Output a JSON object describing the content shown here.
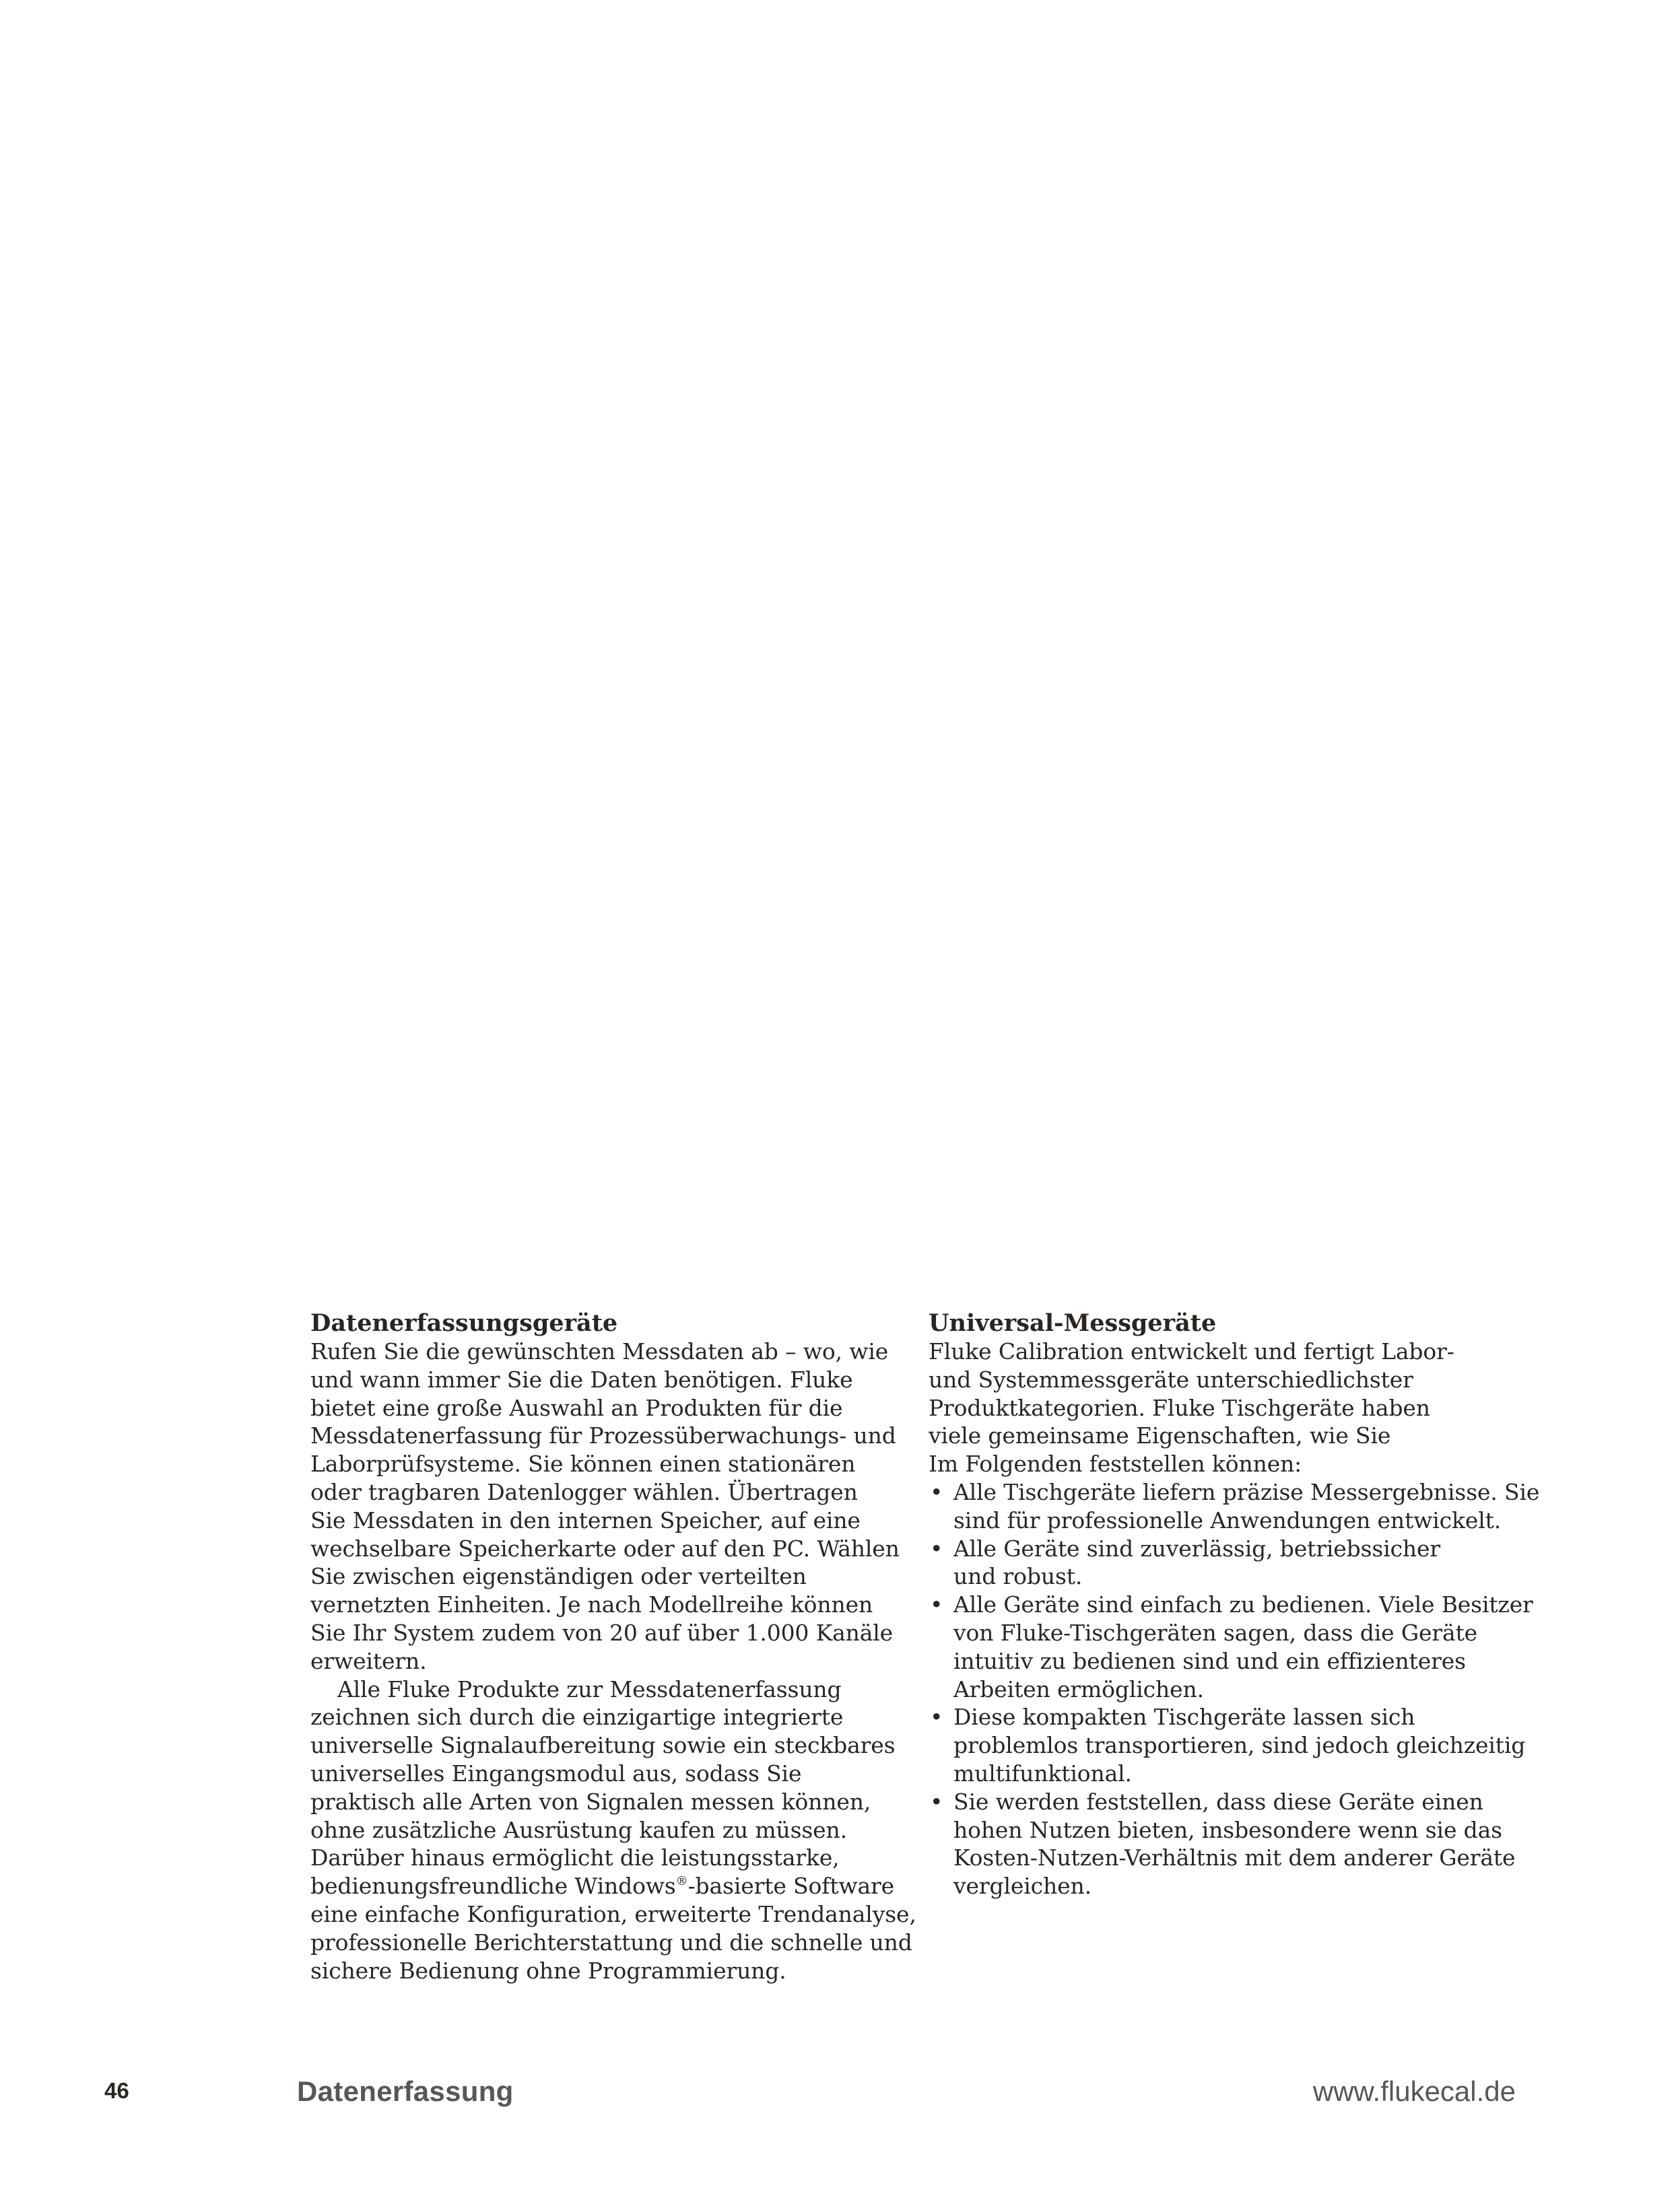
{
  "left_column": {
    "heading": "Datenerfassungsgeräte",
    "paragraph1": [
      "Rufen Sie die gewünschten Messdaten ab – wo, wie",
      "und wann immer Sie die Daten benötigen. Fluke",
      "bietet eine große Auswahl an Produkten für die",
      "Messdatenerfassung für Prozessüberwachungs- und",
      "Laborprüfsysteme. Sie können einen stationären",
      "oder tragbaren Datenlogger wählen. Übertragen",
      "Sie Messdaten in den internen Speicher, auf eine",
      "wechselbare Speicherkarte oder auf den PC. Wählen",
      "Sie zwischen eigenständigen oder verteilten",
      "vernetzten Einheiten. Je nach Modellreihe können",
      "Sie Ihr System zudem von 20 auf über 1.000 Kanäle",
      "erweitern."
    ],
    "paragraph2": [
      "Alle Fluke Produkte zur Messdatenerfassung",
      "zeichnen sich durch die einzigartige integrierte",
      "universelle Signalaufbereitung sowie ein steckbares",
      "universelles Eingangsmodul aus, sodass Sie",
      "praktisch alle Arten von Signalen messen können,",
      "ohne zusätzliche Ausrüstung kaufen zu müssen.",
      "Darüber hinaus ermöglicht die leistungsstarke,"
    ],
    "windows_line": {
      "before": "bedienungsfreundliche Windows",
      "reg": "®",
      "after": "-basierte Software"
    },
    "paragraph2_end": [
      "eine einfache Konfiguration, erweiterte Trendanalyse,",
      "professionelle Berichterstattung und die schnelle und",
      "sichere Bedienung ohne Programmierung."
    ]
  },
  "right_column": {
    "heading": "Universal-Messgeräte",
    "intro": [
      "Fluke Calibration entwickelt und fertigt Labor-",
      "und Systemmessgeräte unterschiedlichster",
      "Produktkategorien. Fluke Tischgeräte haben",
      "viele gemeinsame Eigenschaften, wie Sie",
      "Im Folgenden feststellen können:"
    ],
    "bullet_symbol": "•",
    "bullets": [
      [
        "Alle Tischgeräte liefern präzise Messergebnisse. Sie",
        "sind für professionelle Anwendungen entwickelt."
      ],
      [
        "Alle Geräte sind zuverlässig, betriebssicher",
        "und robust."
      ],
      [
        "Alle Geräte sind einfach zu bedienen. Viele Besitzer",
        "von Fluke-Tischgeräten sagen, dass die Geräte",
        "intuitiv zu bedienen sind und ein effizienteres",
        "Arbeiten ermöglichen."
      ],
      [
        "Diese kompakten Tischgeräte lassen sich",
        "problemlos transportieren, sind jedoch gleichzeitig",
        "multifunktional."
      ],
      [
        "Sie werden feststellen, dass diese Geräte einen",
        "hohen Nutzen bieten, insbesondere wenn sie das",
        "Kosten-Nutzen-Verhältnis mit dem anderer Geräte",
        "vergleichen."
      ]
    ]
  },
  "footer": {
    "page_number": "46",
    "section": "Datenerfassung",
    "url": "www.flukecal.de"
  }
}
